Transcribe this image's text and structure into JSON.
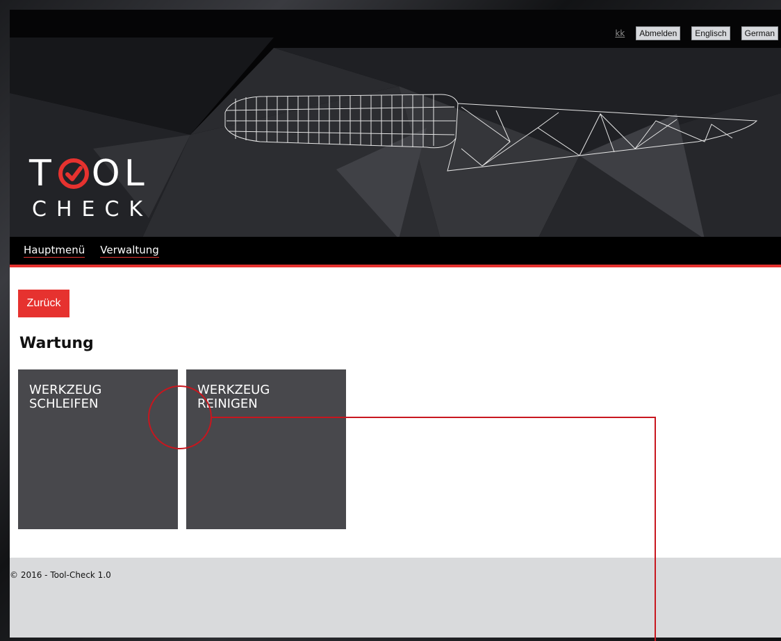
{
  "topbar": {
    "user": "kk",
    "logout_label": "Abmelden",
    "english_label": "Englisch",
    "german_label": "German"
  },
  "logo": {
    "line1_left": "T",
    "line1_right": "OL",
    "line2": "CHECK"
  },
  "nav": {
    "items": [
      {
        "label": "Hauptmenü"
      },
      {
        "label": "Verwaltung"
      }
    ]
  },
  "main": {
    "back_label": "Zurück",
    "title": "Wartung",
    "tiles": [
      {
        "line1": "WERKZEUG",
        "line2": "SCHLEIFEN"
      },
      {
        "line1": "WERKZEUG",
        "line2": "REINIGEN"
      }
    ]
  },
  "footer": {
    "copyright": "© 2016 - Tool-Check 1.0"
  },
  "colors": {
    "accent": "#e6322f",
    "tile": "#48484c",
    "footer": "#d9dadc",
    "header": "#050506"
  },
  "icons": [
    "check-circle-icon",
    "knife-wireframe-illustration"
  ]
}
